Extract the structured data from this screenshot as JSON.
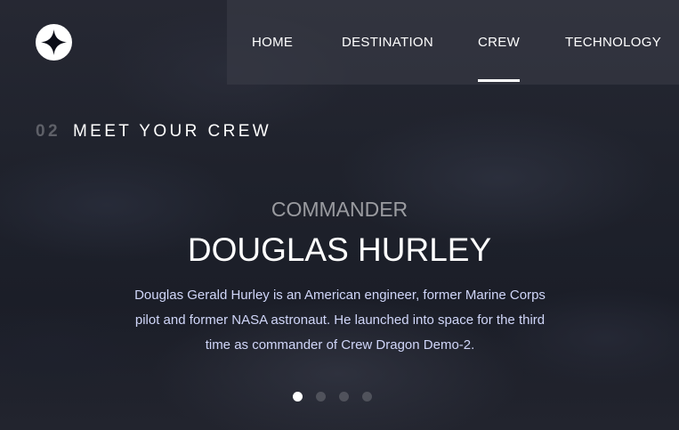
{
  "nav": {
    "items": [
      {
        "label": "HOME",
        "active": false
      },
      {
        "label": "DESTINATION",
        "active": false
      },
      {
        "label": "CREW",
        "active": true
      },
      {
        "label": "TECHNOLOGY",
        "active": false
      }
    ]
  },
  "page_heading": {
    "number": "02",
    "title": "MEET YOUR CREW"
  },
  "crew": {
    "role": "COMMANDER",
    "name": "DOUGLAS HURLEY",
    "bio": "Douglas Gerald Hurley is an American engineer, former Marine Corps pilot and former NASA astronaut. He launched into space for the third time as commander of Crew Dragon Demo-2."
  },
  "carousel": {
    "count": 4,
    "active_index": 0
  },
  "icons": {
    "logo": "four-point-star-icon"
  },
  "colors": {
    "background": "#1f222c",
    "text": "#ffffff",
    "bio_text": "#d0d6f9",
    "nav_background": "rgba(60,62,72,0.55)"
  }
}
